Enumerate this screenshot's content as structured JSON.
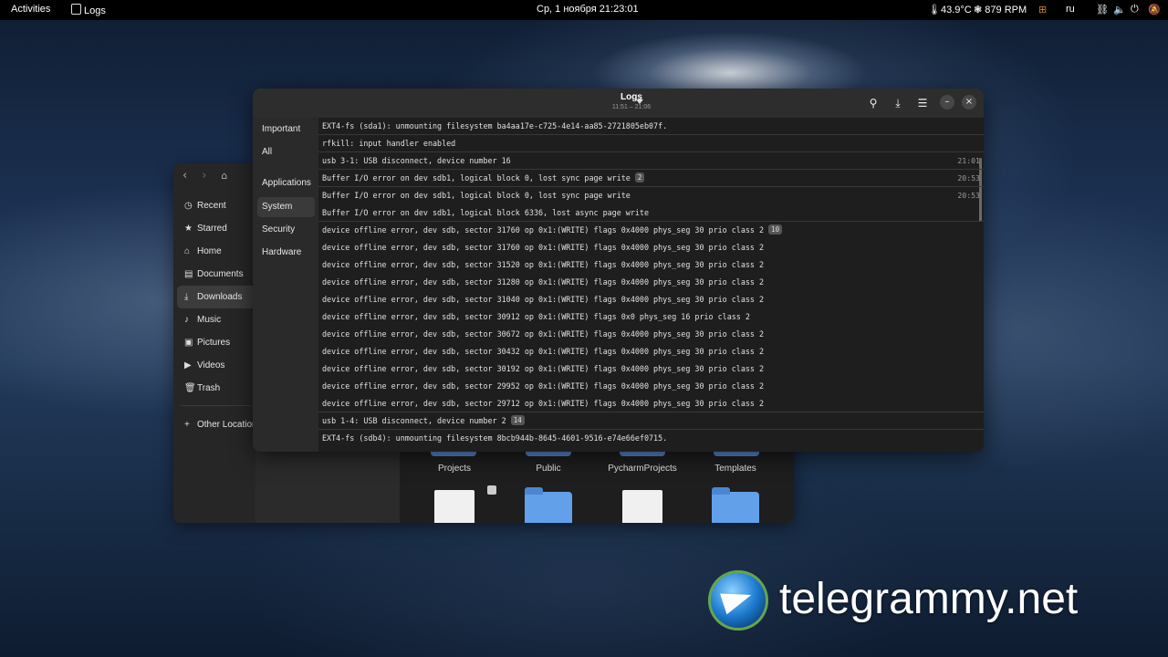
{
  "topbar": {
    "activities": "Activities",
    "app_name": "Logs",
    "clock": "Ср, 1 ноября  21:23:01",
    "temperature": "43.9°C",
    "fan": "879 RPM",
    "language": "ru"
  },
  "file_manager": {
    "sidebar": [
      {
        "label": "Recent",
        "icon": "clock-icon"
      },
      {
        "label": "Starred",
        "icon": "star-icon"
      },
      {
        "label": "Home",
        "icon": "home-icon"
      },
      {
        "label": "Documents",
        "icon": "document-icon"
      },
      {
        "label": "Downloads",
        "icon": "download-icon"
      },
      {
        "label": "Music",
        "icon": "music-icon"
      },
      {
        "label": "Pictures",
        "icon": "picture-icon"
      },
      {
        "label": "Videos",
        "icon": "video-icon"
      },
      {
        "label": "Trash",
        "icon": "trash-icon"
      }
    ],
    "other_locations": "Other Locations",
    "folders": [
      "Projects",
      "Public",
      "PycharmProjects",
      "Templates"
    ]
  },
  "logs": {
    "title": "Logs",
    "subtitle": "11:51 – 21:06",
    "categories": [
      "Important",
      "All",
      "Applications",
      "System",
      "Security",
      "Hardware"
    ],
    "active_category": "System",
    "entries": [
      {
        "text": "EXT4-fs (sda1): unmounting filesystem ba4aa17e-c725-4e14-aa85-2721805eb07f.",
        "time": "",
        "count": ""
      },
      {
        "text": "rfkill: input handler enabled",
        "time": "",
        "count": ""
      },
      {
        "text": "usb 3-1: USB disconnect, device number 16",
        "time": "21:01",
        "count": ""
      },
      {
        "text": "Buffer I/O error on dev sdb1, logical block 0, lost sync page write",
        "time": "20:53",
        "count": "2"
      },
      {
        "text": "Buffer I/O error on dev sdb1, logical block 0, lost sync page write",
        "time": "20:53",
        "count": ""
      },
      {
        "text": "Buffer I/O error on dev sdb1, logical block 6336, lost async page write",
        "time": "",
        "count": ""
      },
      {
        "text": "device offline error, dev sdb, sector 31760 op 0x1:(WRITE) flags 0x4000 phys_seg 30 prio class 2",
        "time": "",
        "count": "10"
      },
      {
        "text": "device offline error, dev sdb, sector 31760 op 0x1:(WRITE) flags 0x4000 phys_seg 30 prio class 2",
        "time": "",
        "count": ""
      },
      {
        "text": "device offline error, dev sdb, sector 31520 op 0x1:(WRITE) flags 0x4000 phys_seg 30 prio class 2",
        "time": "",
        "count": ""
      },
      {
        "text": "device offline error, dev sdb, sector 31280 op 0x1:(WRITE) flags 0x4000 phys_seg 30 prio class 2",
        "time": "",
        "count": ""
      },
      {
        "text": "device offline error, dev sdb, sector 31040 op 0x1:(WRITE) flags 0x4000 phys_seg 30 prio class 2",
        "time": "",
        "count": ""
      },
      {
        "text": "device offline error, dev sdb, sector 30912 op 0x1:(WRITE) flags 0x0 phys_seg 16 prio class 2",
        "time": "",
        "count": ""
      },
      {
        "text": "device offline error, dev sdb, sector 30672 op 0x1:(WRITE) flags 0x4000 phys_seg 30 prio class 2",
        "time": "",
        "count": ""
      },
      {
        "text": "device offline error, dev sdb, sector 30432 op 0x1:(WRITE) flags 0x4000 phys_seg 30 prio class 2",
        "time": "",
        "count": ""
      },
      {
        "text": "device offline error, dev sdb, sector 30192 op 0x1:(WRITE) flags 0x4000 phys_seg 30 prio class 2",
        "time": "",
        "count": ""
      },
      {
        "text": "device offline error, dev sdb, sector 29952 op 0x1:(WRITE) flags 0x4000 phys_seg 30 prio class 2",
        "time": "",
        "count": ""
      },
      {
        "text": "device offline error, dev sdb, sector 29712 op 0x1:(WRITE) flags 0x4000 phys_seg 30 prio class 2",
        "time": "",
        "count": ""
      },
      {
        "text": "usb 1-4: USB disconnect, device number 2",
        "time": "",
        "count": "14"
      },
      {
        "text": "EXT4-fs (sdb4): unmounting filesystem 8bcb944b-8645-4601-9516-e74e66ef0715.",
        "time": "",
        "count": ""
      }
    ]
  },
  "watermark": "telegrammy.net"
}
